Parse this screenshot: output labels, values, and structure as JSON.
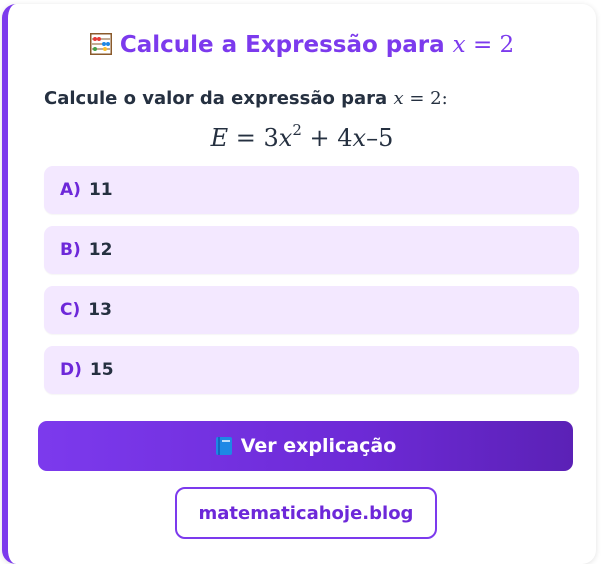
{
  "header": {
    "icon": "abacus-icon",
    "title_text": "Calcule a Expressão para",
    "title_var": "x",
    "title_eq": "= 2"
  },
  "question": {
    "text": "Calcule o valor da expressão para",
    "var": "x",
    "eq": "= 2:"
  },
  "formula": {
    "lhs": "E",
    "eq": "= 3",
    "var1": "x",
    "exp": "2",
    "plus": "+ 4",
    "var2": "x",
    "tail": "–5"
  },
  "options": [
    {
      "letter": "A)",
      "value": "11"
    },
    {
      "letter": "B)",
      "value": "12"
    },
    {
      "letter": "C)",
      "value": "13"
    },
    {
      "letter": "D)",
      "value": "15"
    }
  ],
  "explain_button": {
    "icon": "book-icon",
    "label": "Ver explicação"
  },
  "footer": {
    "link_label": "matematicahoje.blog"
  },
  "colors": {
    "accent": "#7c3aed",
    "option_bg": "#f3e8ff",
    "text_dark": "#253040"
  }
}
